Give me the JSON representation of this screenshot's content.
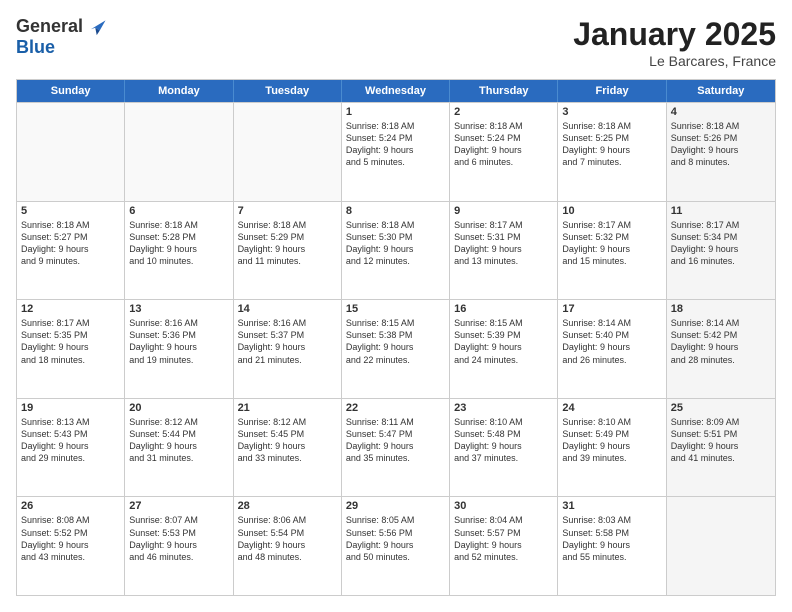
{
  "header": {
    "logo_general": "General",
    "logo_blue": "Blue",
    "month_title": "January 2025",
    "location": "Le Barcares, France"
  },
  "days_of_week": [
    "Sunday",
    "Monday",
    "Tuesday",
    "Wednesday",
    "Thursday",
    "Friday",
    "Saturday"
  ],
  "rows": [
    [
      {
        "day": "",
        "info": "",
        "empty": true
      },
      {
        "day": "",
        "info": "",
        "empty": true
      },
      {
        "day": "",
        "info": "",
        "empty": true
      },
      {
        "day": "1",
        "info": "Sunrise: 8:18 AM\nSunset: 5:24 PM\nDaylight: 9 hours\nand 5 minutes."
      },
      {
        "day": "2",
        "info": "Sunrise: 8:18 AM\nSunset: 5:24 PM\nDaylight: 9 hours\nand 6 minutes."
      },
      {
        "day": "3",
        "info": "Sunrise: 8:18 AM\nSunset: 5:25 PM\nDaylight: 9 hours\nand 7 minutes."
      },
      {
        "day": "4",
        "info": "Sunrise: 8:18 AM\nSunset: 5:26 PM\nDaylight: 9 hours\nand 8 minutes.",
        "shaded": true
      }
    ],
    [
      {
        "day": "5",
        "info": "Sunrise: 8:18 AM\nSunset: 5:27 PM\nDaylight: 9 hours\nand 9 minutes."
      },
      {
        "day": "6",
        "info": "Sunrise: 8:18 AM\nSunset: 5:28 PM\nDaylight: 9 hours\nand 10 minutes."
      },
      {
        "day": "7",
        "info": "Sunrise: 8:18 AM\nSunset: 5:29 PM\nDaylight: 9 hours\nand 11 minutes."
      },
      {
        "day": "8",
        "info": "Sunrise: 8:18 AM\nSunset: 5:30 PM\nDaylight: 9 hours\nand 12 minutes."
      },
      {
        "day": "9",
        "info": "Sunrise: 8:17 AM\nSunset: 5:31 PM\nDaylight: 9 hours\nand 13 minutes."
      },
      {
        "day": "10",
        "info": "Sunrise: 8:17 AM\nSunset: 5:32 PM\nDaylight: 9 hours\nand 15 minutes."
      },
      {
        "day": "11",
        "info": "Sunrise: 8:17 AM\nSunset: 5:34 PM\nDaylight: 9 hours\nand 16 minutes.",
        "shaded": true
      }
    ],
    [
      {
        "day": "12",
        "info": "Sunrise: 8:17 AM\nSunset: 5:35 PM\nDaylight: 9 hours\nand 18 minutes."
      },
      {
        "day": "13",
        "info": "Sunrise: 8:16 AM\nSunset: 5:36 PM\nDaylight: 9 hours\nand 19 minutes."
      },
      {
        "day": "14",
        "info": "Sunrise: 8:16 AM\nSunset: 5:37 PM\nDaylight: 9 hours\nand 21 minutes."
      },
      {
        "day": "15",
        "info": "Sunrise: 8:15 AM\nSunset: 5:38 PM\nDaylight: 9 hours\nand 22 minutes."
      },
      {
        "day": "16",
        "info": "Sunrise: 8:15 AM\nSunset: 5:39 PM\nDaylight: 9 hours\nand 24 minutes."
      },
      {
        "day": "17",
        "info": "Sunrise: 8:14 AM\nSunset: 5:40 PM\nDaylight: 9 hours\nand 26 minutes."
      },
      {
        "day": "18",
        "info": "Sunrise: 8:14 AM\nSunset: 5:42 PM\nDaylight: 9 hours\nand 28 minutes.",
        "shaded": true
      }
    ],
    [
      {
        "day": "19",
        "info": "Sunrise: 8:13 AM\nSunset: 5:43 PM\nDaylight: 9 hours\nand 29 minutes."
      },
      {
        "day": "20",
        "info": "Sunrise: 8:12 AM\nSunset: 5:44 PM\nDaylight: 9 hours\nand 31 minutes."
      },
      {
        "day": "21",
        "info": "Sunrise: 8:12 AM\nSunset: 5:45 PM\nDaylight: 9 hours\nand 33 minutes."
      },
      {
        "day": "22",
        "info": "Sunrise: 8:11 AM\nSunset: 5:47 PM\nDaylight: 9 hours\nand 35 minutes."
      },
      {
        "day": "23",
        "info": "Sunrise: 8:10 AM\nSunset: 5:48 PM\nDaylight: 9 hours\nand 37 minutes."
      },
      {
        "day": "24",
        "info": "Sunrise: 8:10 AM\nSunset: 5:49 PM\nDaylight: 9 hours\nand 39 minutes."
      },
      {
        "day": "25",
        "info": "Sunrise: 8:09 AM\nSunset: 5:51 PM\nDaylight: 9 hours\nand 41 minutes.",
        "shaded": true
      }
    ],
    [
      {
        "day": "26",
        "info": "Sunrise: 8:08 AM\nSunset: 5:52 PM\nDaylight: 9 hours\nand 43 minutes."
      },
      {
        "day": "27",
        "info": "Sunrise: 8:07 AM\nSunset: 5:53 PM\nDaylight: 9 hours\nand 46 minutes."
      },
      {
        "day": "28",
        "info": "Sunrise: 8:06 AM\nSunset: 5:54 PM\nDaylight: 9 hours\nand 48 minutes."
      },
      {
        "day": "29",
        "info": "Sunrise: 8:05 AM\nSunset: 5:56 PM\nDaylight: 9 hours\nand 50 minutes."
      },
      {
        "day": "30",
        "info": "Sunrise: 8:04 AM\nSunset: 5:57 PM\nDaylight: 9 hours\nand 52 minutes."
      },
      {
        "day": "31",
        "info": "Sunrise: 8:03 AM\nSunset: 5:58 PM\nDaylight: 9 hours\nand 55 minutes."
      },
      {
        "day": "",
        "info": "",
        "empty": true,
        "shaded": true
      }
    ]
  ]
}
